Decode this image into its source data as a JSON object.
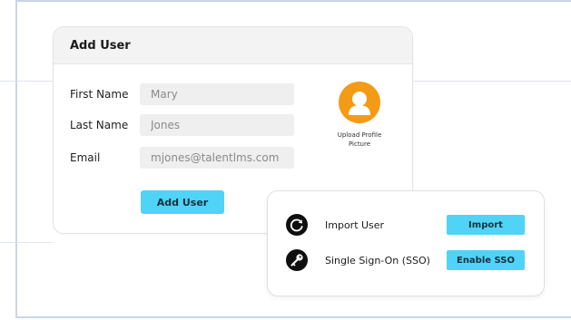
{
  "add_user_card": {
    "title": "Add User",
    "fields": [
      {
        "label": "First Name",
        "value": "Mary"
      },
      {
        "label": "Last Name",
        "value": "Jones"
      },
      {
        "label": "Email",
        "value": "mjones@talentlms.com"
      }
    ],
    "submit_label": "Add User",
    "avatar": {
      "icon": "user-icon",
      "upload_label": "Upload Profile Picture"
    }
  },
  "actions_card": {
    "rows": [
      {
        "icon": "refresh-icon",
        "label": "Import User",
        "button": "Import"
      },
      {
        "icon": "key-icon",
        "label": "Single Sign-On (SSO)",
        "button": "Enable SSO"
      }
    ]
  },
  "colors": {
    "accent_button": "#4fd3f7",
    "avatar_bg": "#f39a16",
    "frame_border": "#c9d6e6"
  }
}
